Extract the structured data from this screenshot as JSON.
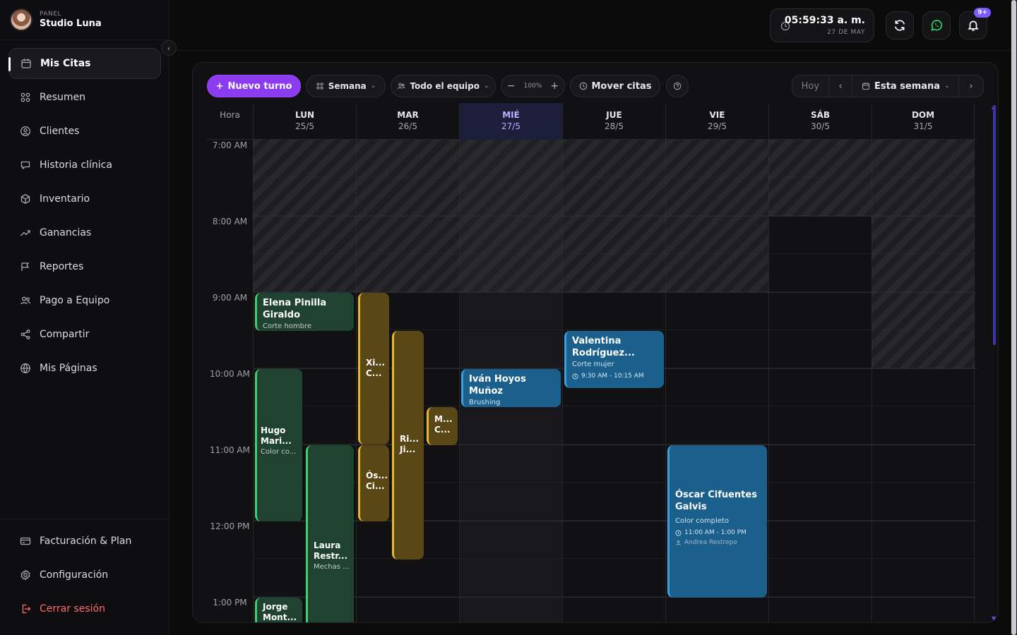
{
  "brand": {
    "kicker": "PANEL",
    "name": "Studio Luna"
  },
  "nav": [
    {
      "label": "Mis Citas",
      "icon": "calendar-icon",
      "active": true
    },
    {
      "label": "Resumen",
      "icon": "grid-icon"
    },
    {
      "label": "Clientes",
      "icon": "user-circle-icon"
    },
    {
      "label": "Historia clínica",
      "icon": "chat-bubble-icon"
    },
    {
      "label": "Inventario",
      "icon": "box-icon"
    },
    {
      "label": "Ganancias",
      "icon": "trend-up-icon"
    },
    {
      "label": "Reportes",
      "icon": "flag-icon"
    },
    {
      "label": "Pago a Equipo",
      "icon": "users-icon"
    },
    {
      "label": "Compartir",
      "icon": "share-icon"
    },
    {
      "label": "Mis Páginas",
      "icon": "globe-icon"
    }
  ],
  "nav_bottom": [
    {
      "label": "Facturación & Plan",
      "icon": "credit-card-icon"
    },
    {
      "label": "Configuración",
      "icon": "gear-icon"
    },
    {
      "label": "Cerrar sesión",
      "icon": "logout-icon"
    }
  ],
  "topbar": {
    "time": "05:59:33 a. m.",
    "date": "27 DE MAY",
    "notifications_badge": "9+"
  },
  "toolbar": {
    "new_appointment": "Nuevo turno",
    "view": "Semana",
    "team": "Todo el equipo",
    "zoom": "100%",
    "move": "Mover citas",
    "today": "Hoy",
    "range": "Esta semana"
  },
  "calendar": {
    "hour_header": "Hora",
    "days": [
      {
        "name": "LUN",
        "date": "25/5"
      },
      {
        "name": "MAR",
        "date": "26/5"
      },
      {
        "name": "MIÉ",
        "date": "27/5",
        "today": true
      },
      {
        "name": "JUE",
        "date": "28/5"
      },
      {
        "name": "VIE",
        "date": "29/5"
      },
      {
        "name": "SÁB",
        "date": "30/5"
      },
      {
        "name": "DOM",
        "date": "31/5"
      }
    ],
    "hours": [
      "7:00 AM",
      "8:00 AM",
      "9:00 AM",
      "10:00 AM",
      "11:00 AM",
      "12:00 PM",
      "1:00 PM"
    ],
    "events": {
      "elena": {
        "name": "Elena Pinilla Giraldo",
        "service": "Corte hombre"
      },
      "hugo": {
        "name": "Hugo Mari...",
        "service": "Color co..."
      },
      "laura": {
        "name": "Laura Restr...",
        "service": "Mechas ..."
      },
      "jorge": {
        "name": "Jorge Mont..."
      },
      "xi": {
        "name": "Xi... C..."
      },
      "os": {
        "name": "Ós... Ci..."
      },
      "ri": {
        "name": "Ri... Ji..."
      },
      "m": {
        "name": "M... C..."
      },
      "ivan": {
        "name": "Iván Hoyos Muñoz",
        "service": "Brushing"
      },
      "valentina": {
        "name": "Valentina Rodríguez...",
        "service": "Corte mujer",
        "time": "9:30 AM - 10:15 AM"
      },
      "oscar": {
        "name": "Óscar Cifuentes Galvis",
        "service": "Color completo",
        "time": "11:00 AM - 1:00 PM",
        "staff": "Andrea Restrepo"
      }
    }
  },
  "colors": {
    "accent": "#8b3cf0",
    "green": "#3ccf6e",
    "yellow": "#e9b825",
    "blue": "#3aa0e0",
    "danger": "#ff6b6b"
  }
}
